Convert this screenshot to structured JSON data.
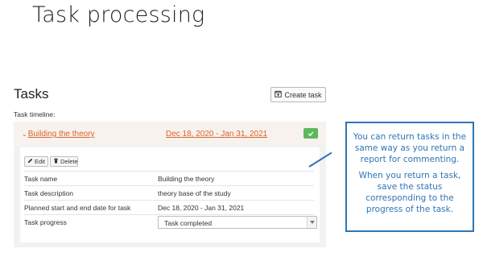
{
  "slide": {
    "title": "Task processing"
  },
  "tasks": {
    "heading": "Tasks",
    "create_label": "Create task",
    "timeline_label": "Task timeline:"
  },
  "task": {
    "name_link": "Building the theory",
    "date_range": "Dec 18, 2020 - Jan 31, 2021",
    "status_color": "#5cb85c",
    "edit_label": "Edit",
    "delete_label": "Delete",
    "fields": [
      {
        "label": "Task name",
        "value": "Building the theory"
      },
      {
        "label": "Task description",
        "value": "theory base of the study"
      },
      {
        "label": "Planned start and end date for task",
        "value": "Dec 18, 2020 - Jan 31, 2021"
      },
      {
        "label": "Task progress",
        "value": "Task completed"
      }
    ]
  },
  "callout": {
    "p1": "You can return tasks in the same way as you return a report for commenting.",
    "p2": "When you return a task, save the status corresponding to the progress of the task.",
    "color": "#2e75b6"
  },
  "colors": {
    "accent": "#d9652a",
    "success": "#5cb85c"
  }
}
